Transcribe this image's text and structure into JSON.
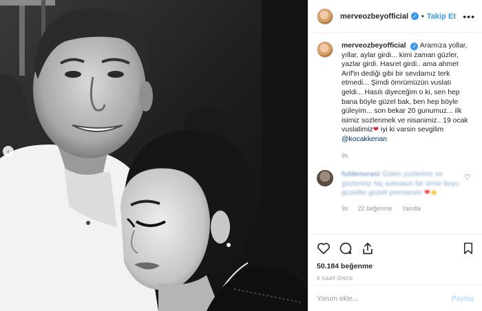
{
  "post": {
    "username": "merveozbeyofficial",
    "follow_label": "Takip Et",
    "separator": "•",
    "more_label": "•••",
    "caption_text": "Aramıza yollar, yıllar, aylar girdi... kimi zaman güzler, yazlar girdi. Hasret girdi.. ama ahmet Arif'in dediği gibi bir sevdamız terk etmedi... Şimdi ömrümüzün vuslatı geldi... Hasılı diyeceğim o ki, sen hep bana böyle güzel bak, ben hep böyle güleyim... son bekar 20 gunumuz... ilk isimiz sozlenmek ve nisanimiz.. 19 ocak vuslatimiz",
    "caption_after_heart": " iyi ki varsin sevgilim",
    "caption_mention": "@kocakkenan",
    "caption_time": "9s"
  },
  "comment": {
    "username": "fuldenurasi",
    "text": "Gülen yüzleriniz ve gözleriniz hiç solmasın bir ömür boyu güzeller güzeli prensesim",
    "time": "9s",
    "likes": "22 beğenme",
    "reply_label": "Yanıtla"
  },
  "actions": {
    "likes_count": "50.184 beğenme",
    "time_ago": "9 SAAT ÖNCE"
  },
  "add_comment": {
    "placeholder": "Yorum ekle...",
    "post_label": "Paylaş"
  },
  "icons": {
    "heart": "heart-icon",
    "comment": "comment-icon",
    "share": "share-icon",
    "bookmark": "bookmark-icon",
    "verified": "verified-badge-icon"
  },
  "colors": {
    "accent": "#3897f0",
    "text": "#262626",
    "muted": "#999999",
    "emoji_heart": "#ed1c24"
  }
}
